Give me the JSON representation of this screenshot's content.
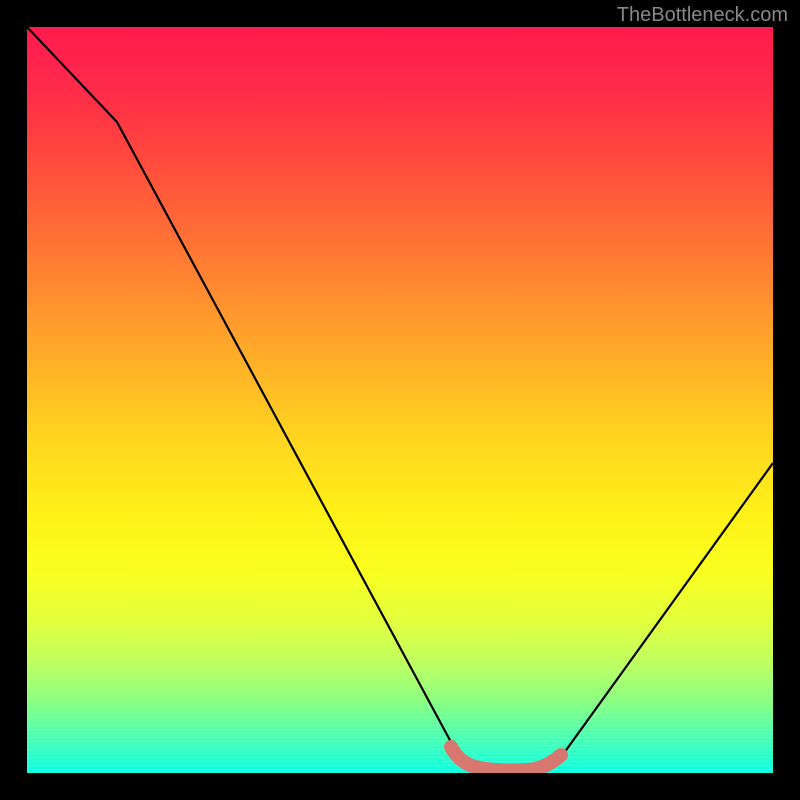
{
  "watermark": "TheBottleneck.com",
  "chart_data": {
    "type": "line",
    "title": "",
    "xlabel": "",
    "ylabel": "",
    "xlim": [
      0,
      100
    ],
    "ylim": [
      0,
      100
    ],
    "series": [
      {
        "name": "bottleneck-curve",
        "x": [
          0,
          12,
          58,
          62,
          68,
          70,
          72,
          100
        ],
        "y": [
          100,
          87,
          2,
          0,
          0,
          1,
          2,
          42
        ]
      }
    ],
    "marker_segment": {
      "name": "highlight-marker",
      "color": "#d8776f",
      "x": [
        57,
        60,
        64,
        68,
        72
      ],
      "y": [
        3,
        1.5,
        0.5,
        0.8,
        2
      ]
    },
    "gradient_stops": [
      {
        "pos": 0,
        "color": "#ff1a4d"
      },
      {
        "pos": 50,
        "color": "#ffd420"
      },
      {
        "pos": 75,
        "color": "#faff20"
      },
      {
        "pos": 100,
        "color": "#10ffe0"
      }
    ]
  }
}
